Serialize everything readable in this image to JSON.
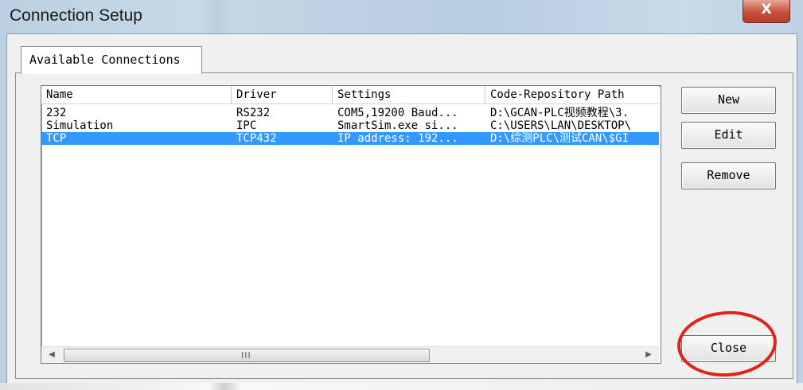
{
  "window": {
    "title": "Connection Setup",
    "close_glyph": "X"
  },
  "tabs": [
    {
      "label": "Available Connections",
      "selected": true
    }
  ],
  "list": {
    "columns": [
      "Name",
      "Driver",
      "Settings",
      "Code-Repository Path"
    ],
    "rows": [
      {
        "name": "232",
        "driver": "RS232",
        "settings": "COM5,19200 Baud...",
        "path": "D:\\GCAN-PLC视频教程\\3.",
        "selected": false
      },
      {
        "name": "Simulation",
        "driver": "IPC",
        "settings": "SmartSim.exe si...",
        "path": "C:\\USERS\\LAN\\DESKTOP\\",
        "selected": false
      },
      {
        "name": "TCP",
        "driver": "TCP432",
        "settings": "IP address: 192...",
        "path": "D:\\综测PLC\\测试CAN\\$GI",
        "selected": true
      }
    ],
    "hscroll": {
      "left_arrow": "◀",
      "right_arrow": "▶",
      "grip": "III"
    }
  },
  "buttons": {
    "new": "New",
    "edit": "Edit",
    "remove": "Remove",
    "close": "Close"
  },
  "colors": {
    "selection": "#3399ff",
    "annotation_circle": "#e2231a"
  }
}
